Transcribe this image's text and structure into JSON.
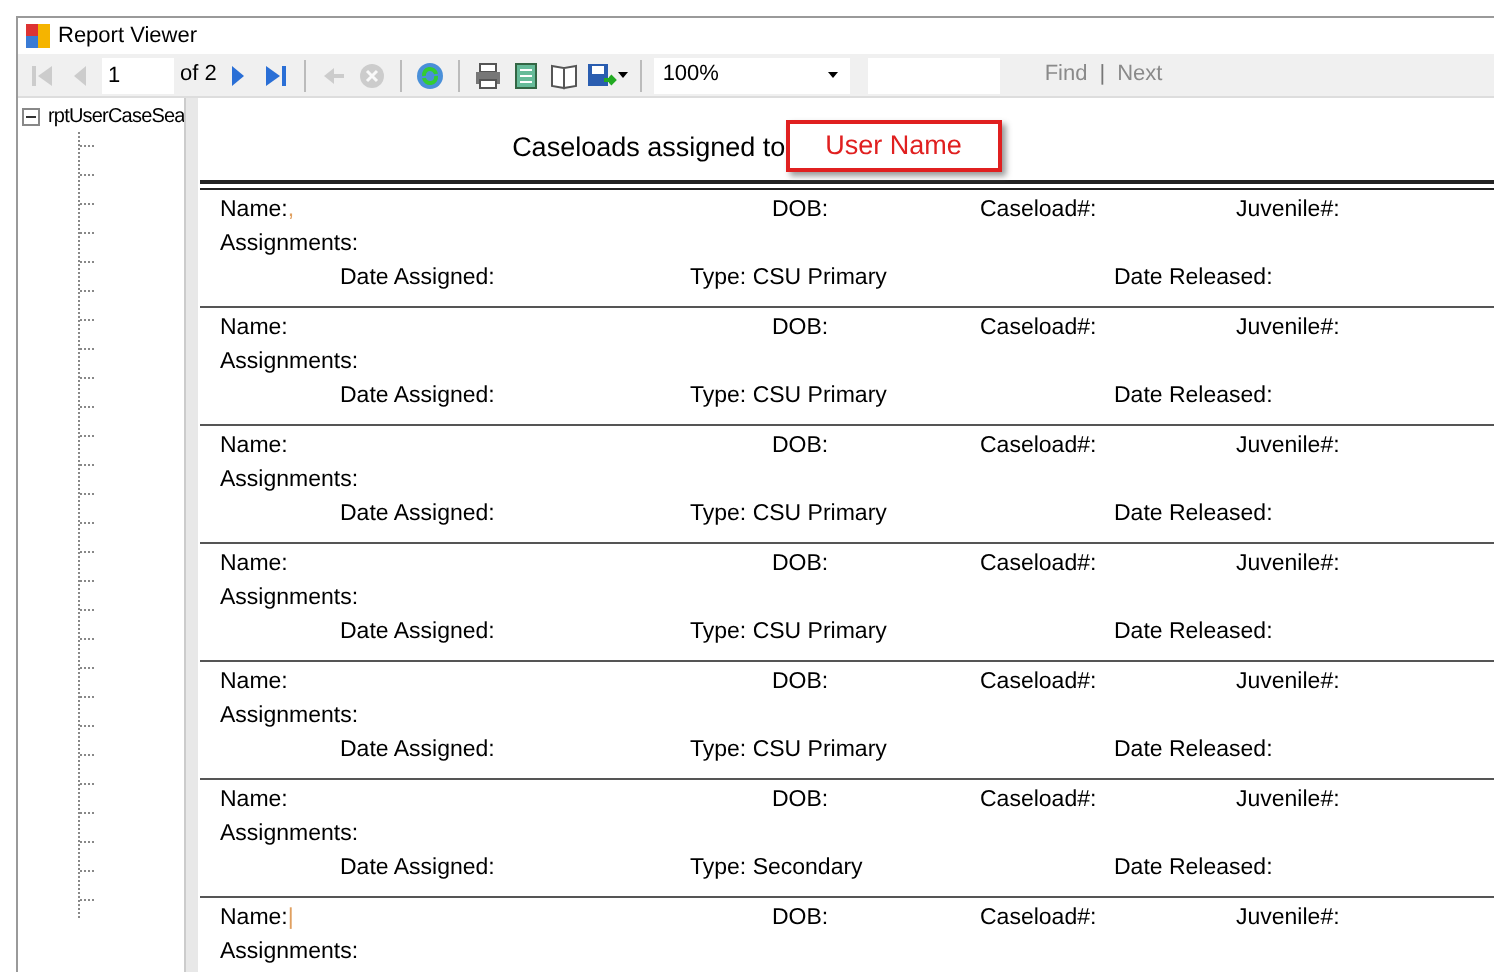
{
  "window": {
    "title": "Report Viewer"
  },
  "toolbar": {
    "nav_buttons": [
      {
        "kind": "first",
        "disabled": true
      },
      {
        "kind": "prev",
        "disabled": true
      }
    ],
    "page": "1",
    "of_label": "of",
    "page_count": "2",
    "nav_buttons_after": [
      {
        "kind": "next",
        "disabled": false
      },
      {
        "kind": "last",
        "disabled": false
      }
    ],
    "action_buttons": [
      {
        "kind": "back",
        "disabled": true
      },
      {
        "kind": "stop",
        "disabled": true
      },
      {
        "kind": "refresh",
        "disabled": false
      },
      {
        "kind": "print",
        "disabled": false
      },
      {
        "kind": "layout",
        "disabled": false
      },
      {
        "kind": "pagesetup",
        "disabled": false
      },
      {
        "kind": "export",
        "disabled": false
      }
    ],
    "zoom": "100%",
    "find_label": "Find",
    "separator": "|",
    "next_label": "Next"
  },
  "tree": {
    "root": {
      "label": "rptUserCaseSea",
      "expanded": true
    }
  },
  "report": {
    "heading": "Caseloads assigned to",
    "user_name": "User Name",
    "records": [
      {
        "name_label": "Name:",
        "name_mark": ",",
        "dob_label": "DOB:",
        "caseload_label": "Caseload#:",
        "juvenile_label": "Juvenile#:",
        "assignments_label": "Assignments:",
        "date_assigned_label": "Date Assigned:",
        "type": "Type: CSU Primary",
        "date_released_label": "Date Released:"
      },
      {
        "name_label": "Name:",
        "dob_label": "DOB:",
        "caseload_label": "Caseload#:",
        "juvenile_label": "Juvenile#:",
        "assignments_label": "Assignments:",
        "date_assigned_label": "Date Assigned:",
        "type": "Type: CSU Primary",
        "date_released_label": "Date Released:"
      },
      {
        "name_label": "Name:",
        "dob_label": "DOB:",
        "caseload_label": "Caseload#:",
        "juvenile_label": "Juvenile#:",
        "assignments_label": "Assignments:",
        "date_assigned_label": "Date Assigned:",
        "type": "Type: CSU Primary",
        "date_released_label": "Date Released:"
      },
      {
        "name_label": "Name:",
        "dob_label": "DOB:",
        "caseload_label": "Caseload#:",
        "juvenile_label": "Juvenile#:",
        "assignments_label": "Assignments:",
        "date_assigned_label": "Date Assigned:",
        "type": "Type: CSU Primary",
        "date_released_label": "Date Released:"
      },
      {
        "name_label": "Name:",
        "dob_label": "DOB:",
        "caseload_label": "Caseload#:",
        "juvenile_label": "Juvenile#:",
        "assignments_label": "Assignments:",
        "date_assigned_label": "Date Assigned:",
        "type": "Type: CSU Primary",
        "date_released_label": "Date Released:"
      },
      {
        "name_label": "Name:",
        "dob_label": "DOB:",
        "caseload_label": "Caseload#:",
        "juvenile_label": "Juvenile#:",
        "assignments_label": "Assignments:",
        "date_assigned_label": "Date Assigned:",
        "type": "Type: Secondary",
        "date_released_label": "Date Released:"
      },
      {
        "name_label": "Name:",
        "name_mark": "|",
        "dob_label": "DOB:",
        "caseload_label": "Caseload#:",
        "juvenile_label": "Juvenile#:",
        "assignments_label": "Assignments:"
      }
    ]
  }
}
